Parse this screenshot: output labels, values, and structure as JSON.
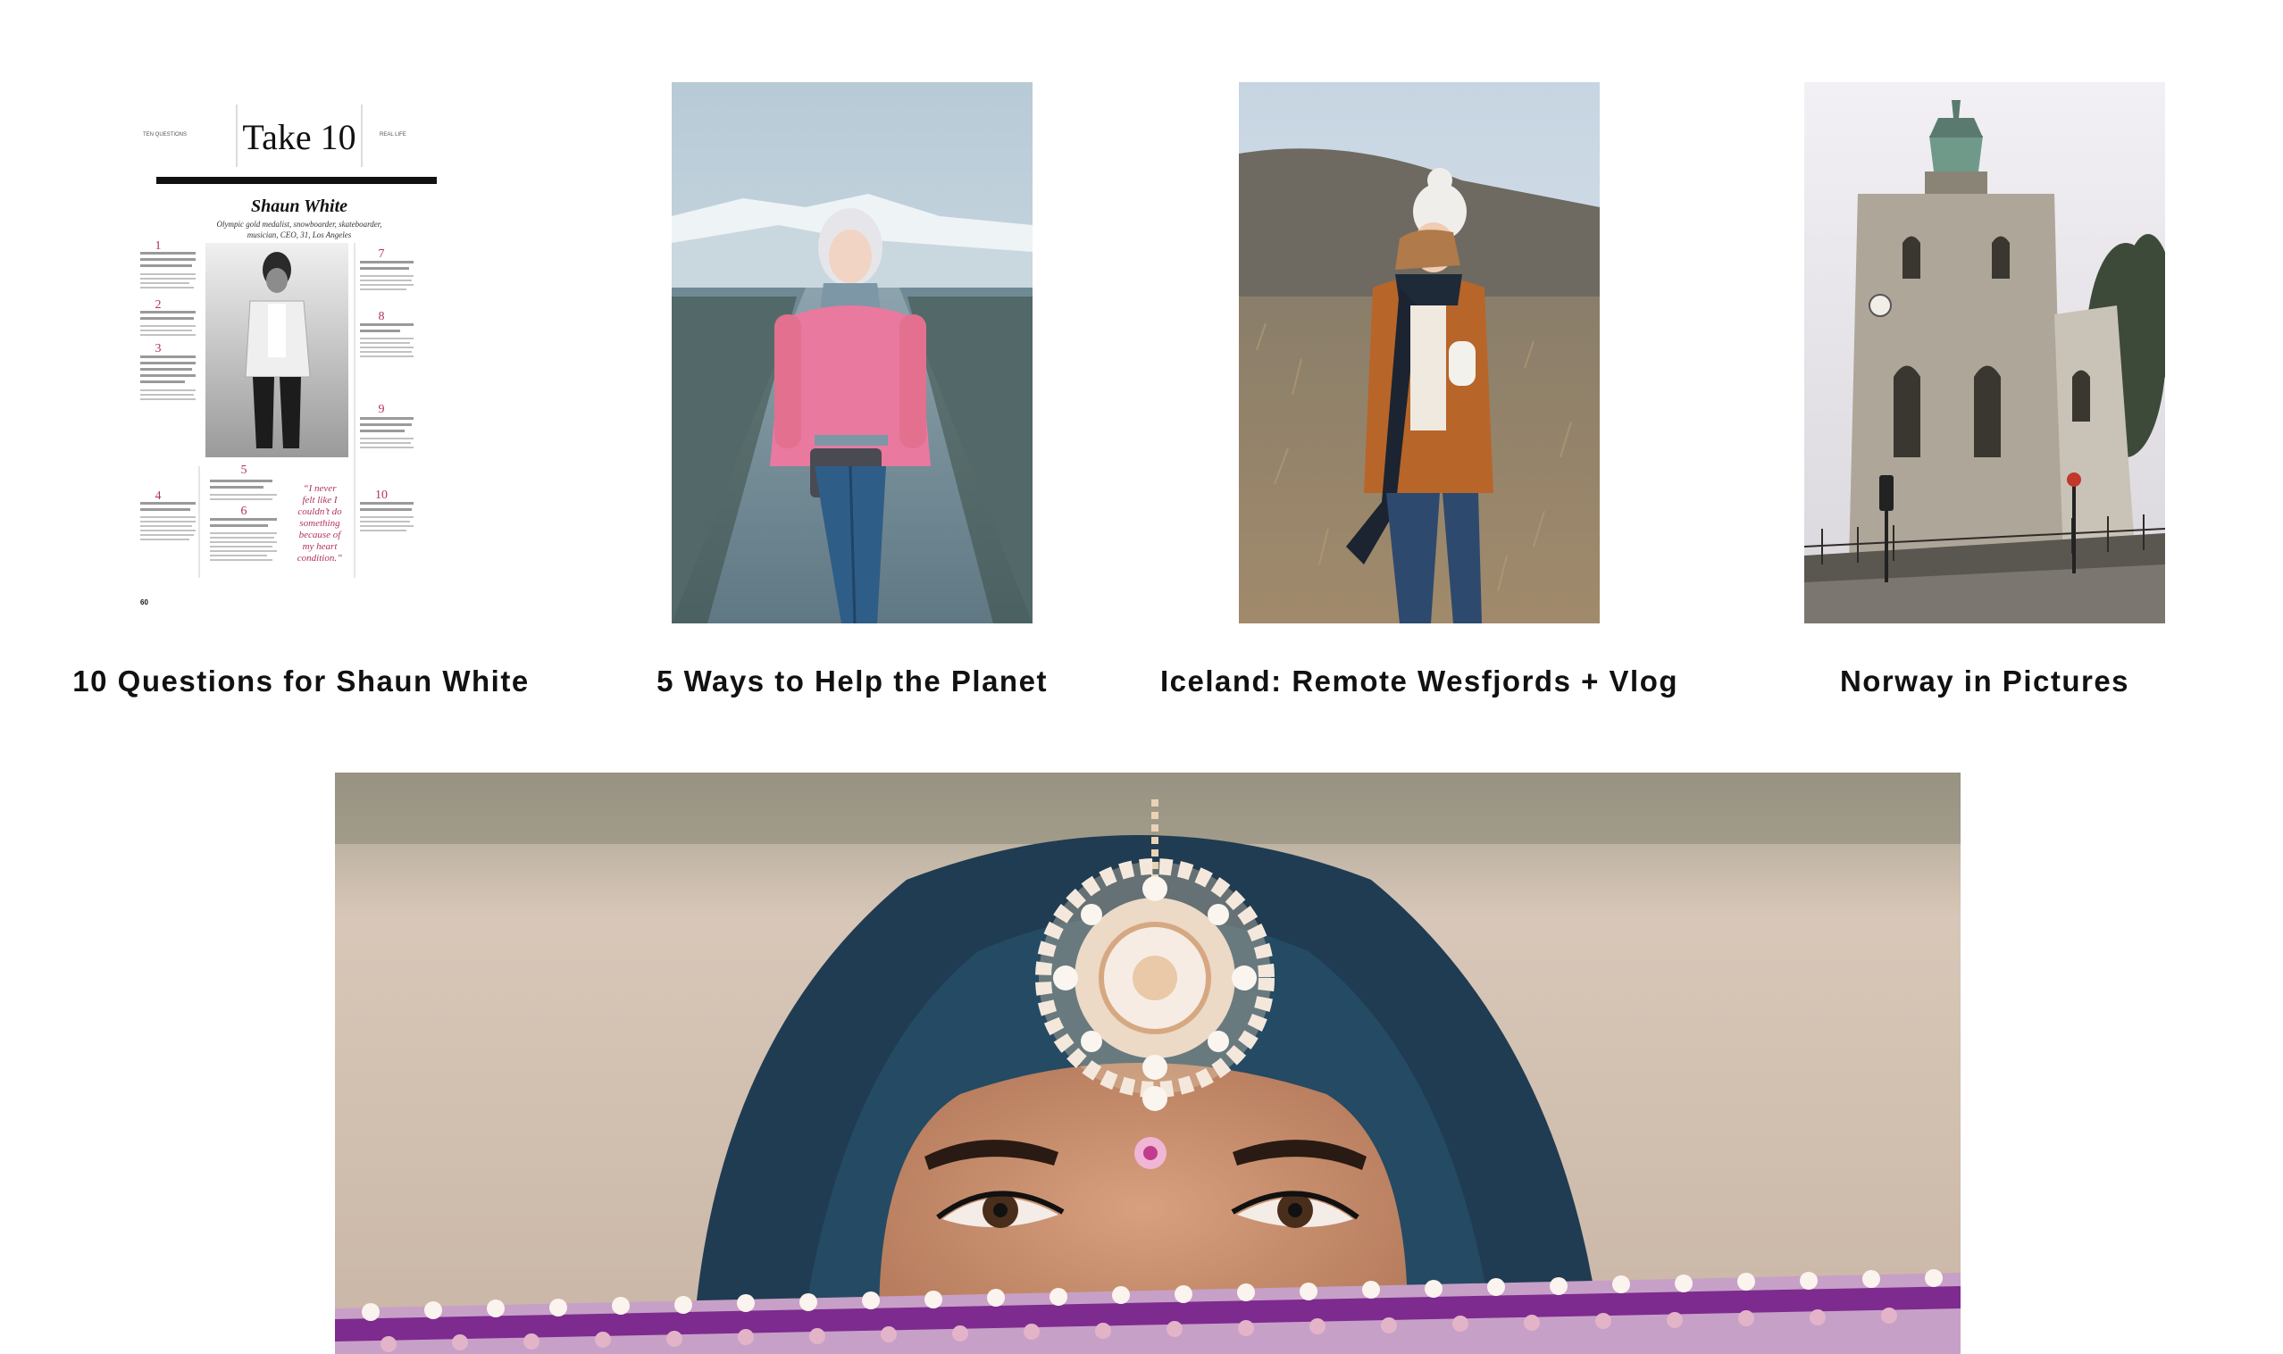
{
  "posts": [
    {
      "title": "10 Questions for Shaun White",
      "image_alt": "Magazine page 'Take 10' interview with Shaun White",
      "magazine": {
        "left_tag": "TEN QUESTIONS",
        "headline": "Take 10",
        "right_tag": "REAL LIFE",
        "name": "Shaun White",
        "subtitle_1": "Olympic gold medalist, snowboarder, skateboarder,",
        "subtitle_2": "musician, CEO, 31, Los Angeles",
        "quote_1": "“I never",
        "quote_2": "felt like I",
        "quote_3": "couldn’t do",
        "quote_4": "something",
        "quote_5": "because of",
        "quote_6": "my heart",
        "quote_7": "condition.”",
        "numbers": [
          "1",
          "2",
          "3",
          "4",
          "5",
          "6",
          "7",
          "8",
          "9",
          "10"
        ],
        "page_number": "60"
      }
    },
    {
      "title": "5 Ways to Help the Planet",
      "image_alt": "Woman in pink coat standing on snowy road"
    },
    {
      "title": "Iceland: Remote Wesfjords + Vlog",
      "image_alt": "Woman in white knit hat and shearling coat in a field"
    },
    {
      "title": "Norway in Pictures",
      "image_alt": "Old stone church tower in Bergen"
    }
  ],
  "featured": {
    "image_alt": "Woman with blue hair wearing a pearl maang tikka, face partially covered"
  },
  "colors": {
    "text": "#111111",
    "accent_pink": "#b0345a",
    "coat_pink": "#e9799f",
    "coat_orange": "#b8652a",
    "hair_blue": "#1f3c52",
    "veil_purple": "#7d2b8f"
  }
}
